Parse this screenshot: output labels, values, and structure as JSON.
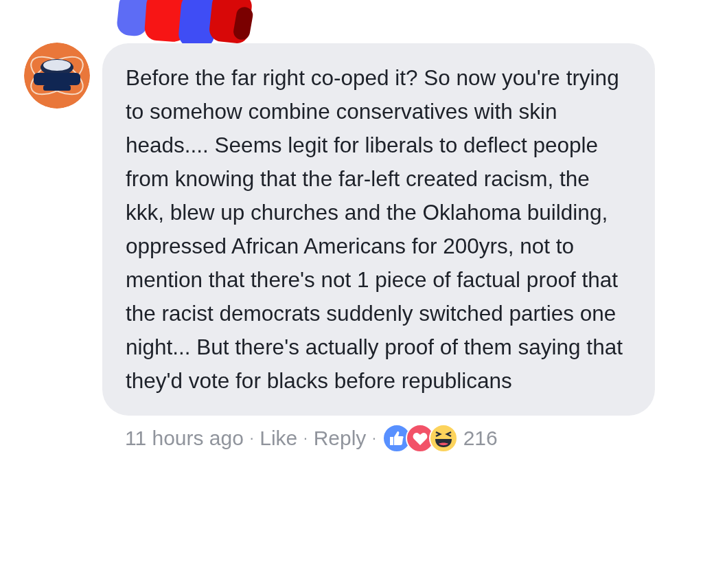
{
  "comment": {
    "text": "Before the far right co-oped it? So now you're trying to somehow combine conservatives with skin heads.... Seems legit for liberals to deflect people from knowing that the far-left created racism, the kkk, blew up churches and the Oklahoma building, oppressed African Americans for 200yrs, not to mention that there's not 1 piece of factual proof that the racist democrats suddenly switched parties one night... But there's actually proof of them saying that they'd vote for blacks before republicans",
    "footer": [
      {
        "kind": "time",
        "text": "11 hours ago"
      },
      {
        "kind": "separator",
        "text": "·"
      },
      {
        "kind": "link",
        "text": "Like"
      },
      {
        "kind": "separator",
        "text": "·"
      },
      {
        "kind": "link",
        "text": "Reply"
      },
      {
        "kind": "separator",
        "text": "·"
      },
      {
        "kind": "reactions"
      },
      {
        "kind": "count",
        "text": "216"
      }
    ]
  }
}
